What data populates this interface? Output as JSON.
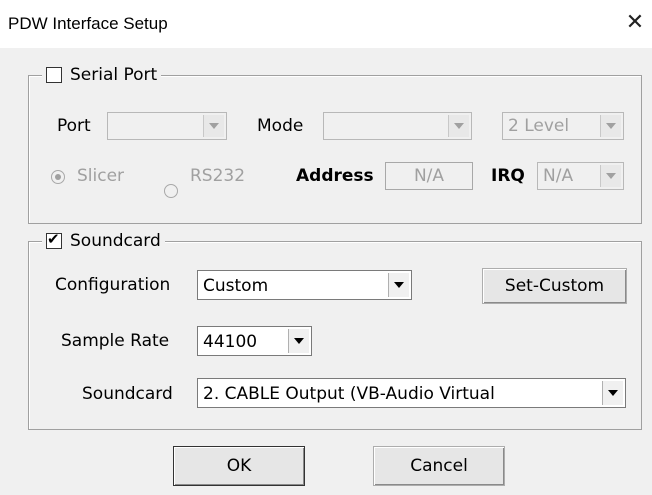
{
  "window": {
    "title": "PDW Interface Setup",
    "close_glyph": "✕"
  },
  "serial": {
    "legend": "Serial Port",
    "checked": false,
    "port_label": "Port",
    "port_value": "",
    "mode_label": "Mode",
    "mode_value": "",
    "level_value": "2 Level",
    "slicer_label": "Slicer",
    "rs232_label": "RS232",
    "address_label": "Address",
    "address_value": "N/A",
    "irq_label": "IRQ",
    "irq_value": "N/A"
  },
  "soundcard": {
    "legend": "Soundcard",
    "checked": true,
    "configuration_label": "Configuration",
    "configuration_value": "Custom",
    "set_custom_label": "Set-Custom",
    "sample_rate_label": "Sample Rate",
    "sample_rate_value": "44100",
    "soundcard_label": "Soundcard",
    "soundcard_value": "2. CABLE Output (VB-Audio Virtual"
  },
  "buttons": {
    "ok": "OK",
    "cancel": "Cancel"
  }
}
